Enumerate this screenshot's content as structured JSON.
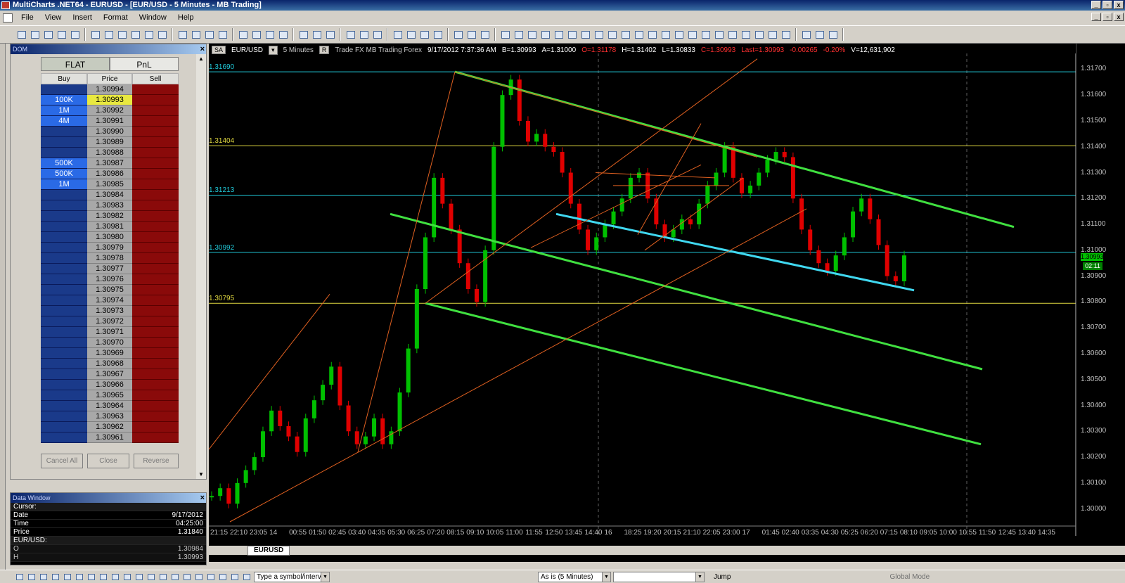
{
  "window": {
    "title": "MultiCharts .NET64 - EURUSD - [EUR/USD - 5 Minutes - MB Trading]"
  },
  "menu": [
    "File",
    "View",
    "Insert",
    "Format",
    "Window",
    "Help"
  ],
  "dom": {
    "header": "DOM",
    "tabs": {
      "flat": "FLAT",
      "pnl": "PnL"
    },
    "columns": {
      "buy": "Buy",
      "price": "Price",
      "sell": "Sell"
    },
    "rows": [
      {
        "buy": "",
        "price": "1.30994"
      },
      {
        "buy": "100K",
        "price": "1.30993",
        "current": true
      },
      {
        "buy": "1M",
        "price": "1.30992"
      },
      {
        "buy": "4M",
        "price": "1.30991"
      },
      {
        "buy": "",
        "price": "1.30990"
      },
      {
        "buy": "",
        "price": "1.30989"
      },
      {
        "buy": "",
        "price": "1.30988"
      },
      {
        "buy": "500K",
        "price": "1.30987"
      },
      {
        "buy": "500K",
        "price": "1.30986"
      },
      {
        "buy": "1M",
        "price": "1.30985"
      },
      {
        "buy": "",
        "price": "1.30984"
      },
      {
        "buy": "",
        "price": "1.30983"
      },
      {
        "buy": "",
        "price": "1.30982"
      },
      {
        "buy": "",
        "price": "1.30981"
      },
      {
        "buy": "",
        "price": "1.30980"
      },
      {
        "buy": "",
        "price": "1.30979"
      },
      {
        "buy": "",
        "price": "1.30978"
      },
      {
        "buy": "",
        "price": "1.30977"
      },
      {
        "buy": "",
        "price": "1.30976"
      },
      {
        "buy": "",
        "price": "1.30975"
      },
      {
        "buy": "",
        "price": "1.30974"
      },
      {
        "buy": "",
        "price": "1.30973"
      },
      {
        "buy": "",
        "price": "1.30972"
      },
      {
        "buy": "",
        "price": "1.30971"
      },
      {
        "buy": "",
        "price": "1.30970"
      },
      {
        "buy": "",
        "price": "1.30969"
      },
      {
        "buy": "",
        "price": "1.30968"
      },
      {
        "buy": "",
        "price": "1.30967"
      },
      {
        "buy": "",
        "price": "1.30966"
      },
      {
        "buy": "",
        "price": "1.30965"
      },
      {
        "buy": "",
        "price": "1.30964"
      },
      {
        "buy": "",
        "price": "1.30963"
      },
      {
        "buy": "",
        "price": "1.30962"
      },
      {
        "buy": "",
        "price": "1.30961"
      }
    ],
    "buttons": {
      "cancel_all": "Cancel All",
      "close": "Close",
      "reverse": "Reverse"
    }
  },
  "data_window": {
    "header": "Data Window",
    "cursor_label": "Cursor:",
    "date_label": "Date",
    "date": "9/17/2012",
    "time_label": "Time",
    "time": "04:25:00",
    "price_label": "Price",
    "price": "1.31840",
    "symbol": "EUR/USD:",
    "o_label": "O",
    "o": "1.30984",
    "h_label": "H",
    "h": "1.30993"
  },
  "chart_info": {
    "sa": "SA",
    "symbol": "EUR/USD",
    "resolution": "5 Minutes",
    "r": "R",
    "desc": "Trade  FX  MB Trading  Forex",
    "datetime": "9/17/2012  7:37:36 AM",
    "bid": "B=1.30993",
    "ask": "A=1.31000",
    "open": "O=1.31178",
    "high": "H=1.31402",
    "low": "L=1.30833",
    "close": "C=1.30993",
    "last": "Last=1.30993",
    "change": "-0.00265",
    "pct": "-0.20%",
    "volume": "V=12,631,902"
  },
  "chart_data": {
    "type": "line",
    "title": "",
    "ylim": [
      1.2995,
      1.3175
    ],
    "y_ticks": [
      "1.31700",
      "1.31600",
      "1.31500",
      "1.31400",
      "1.31300",
      "1.31200",
      "1.31100",
      "1.31000",
      "1.30900",
      "1.30800",
      "1.30700",
      "1.30600",
      "1.30500",
      "1.30400",
      "1.30300",
      "1.30200",
      "1.30100",
      "1.30000"
    ],
    "x_ticks": [
      "21:15",
      "22:10",
      "23:05",
      "14",
      "00:55",
      "01:50",
      "02:45",
      "03:40",
      "04:35",
      "05:30",
      "06:25",
      "07:20",
      "08:15",
      "09:10",
      "10:05",
      "11:00",
      "11:55",
      "12:50",
      "13:45",
      "14:40",
      "16",
      "18:25",
      "19:20",
      "20:15",
      "21:10",
      "22:05",
      "23:00",
      "17",
      "01:45",
      "02:40",
      "03:35",
      "04:30",
      "05:25",
      "06:20",
      "07:15",
      "08:10",
      "09:05",
      "10:00",
      "10:55",
      "11:50",
      "12:45",
      "13:40",
      "14:35"
    ],
    "horizontal_levels": [
      {
        "label": "1.31690",
        "value": 1.3169,
        "color": "#20c8d8"
      },
      {
        "label": "1.31404",
        "value": 1.31404,
        "color": "#e0d840"
      },
      {
        "label": "1.31213",
        "value": 1.31213,
        "color": "#20c8d8"
      },
      {
        "label": "1.30992",
        "value": 1.30992,
        "color": "#20c8d8"
      },
      {
        "label": "1.30795",
        "value": 1.30795,
        "color": "#e0d840"
      }
    ],
    "series": [
      {
        "values": [
          1.3005,
          1.3008,
          1.3002,
          1.301,
          1.3015,
          1.302,
          1.303,
          1.3038,
          1.3032,
          1.3028,
          1.3022,
          1.3035,
          1.3042,
          1.3048,
          1.3055,
          1.304,
          1.303,
          1.3025,
          1.3028,
          1.3035,
          1.3025,
          1.303,
          1.3045,
          1.3062,
          1.3085,
          1.3105,
          1.3128,
          1.3118,
          1.3108,
          1.3095,
          1.3085,
          1.308,
          1.31,
          1.314,
          1.316,
          1.3166,
          1.315,
          1.3142,
          1.3145,
          1.314,
          1.3138,
          1.313,
          1.3118,
          1.3108,
          1.31,
          1.3105,
          1.311,
          1.3115,
          1.312,
          1.3128,
          1.313,
          1.312,
          1.311,
          1.3105,
          1.3108,
          1.3112,
          1.311,
          1.3118,
          1.3125,
          1.313,
          1.314,
          1.3128,
          1.3122,
          1.3125,
          1.313,
          1.3135,
          1.3138,
          1.3136,
          1.312,
          1.3108,
          1.31,
          1.3095,
          1.3092,
          1.3098,
          1.3105,
          1.3115,
          1.312,
          1.3112,
          1.3102,
          1.309,
          1.3088,
          1.3098
        ]
      }
    ],
    "colors": {
      "channel": "#40e040",
      "support": "#40d8f0",
      "fan": "#e06020",
      "up_candle": "#00c000",
      "down_candle": "#e00000"
    }
  },
  "price_tag": "1.30993",
  "time_tag": "02:11",
  "sheet_tab": "EURUSD",
  "bottom": {
    "symbol_placeholder": "Type a symbol/interval",
    "resolution": "As is (5 Minutes)",
    "jump": "Jump",
    "global_mode": "Global Mode"
  }
}
